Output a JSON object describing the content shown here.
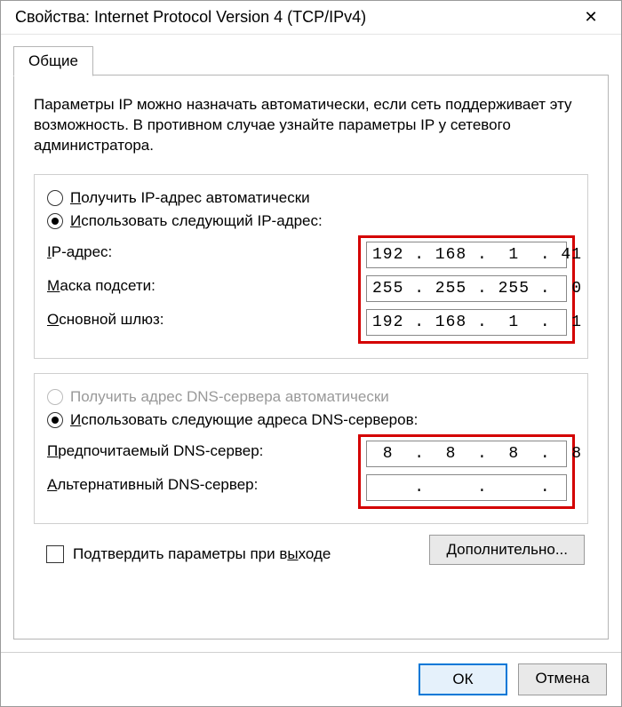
{
  "window": {
    "title": "Свойства: Internet Protocol Version 4 (TCP/IPv4)",
    "close": "✕"
  },
  "tab": {
    "general": "Общие"
  },
  "description": "Параметры IP можно назначать автоматически, если сеть поддерживает эту возможность. В противном случае узнайте параметры IP у сетевого администратора.",
  "ip": {
    "radio_auto": "Получить IP-адрес автоматически",
    "radio_manual_pre": "Использовать следующий IP-адрес:",
    "addr_label": "IP-адрес:",
    "addr_value": "192 . 168 .  1  . 41",
    "mask_label": "Маска подсети:",
    "mask_value": "255 . 255 . 255 .  0",
    "gw_label": "Основной шлюз:",
    "gw_value": "192 . 168 .  1  .  1"
  },
  "dns": {
    "radio_auto": "Получить адрес DNS-сервера автоматически",
    "radio_manual": "Использовать следующие адреса DNS-серверов:",
    "pref_label": "Предпочитаемый DNS-сервер:",
    "pref_value": " 8  .  8  .  8  .  8",
    "alt_label": "Альтернативный DNS-сервер:",
    "alt_value": "    .     .     .   "
  },
  "confirm": "Подтвердить параметры при выходе",
  "advanced": "Дополнительно...",
  "buttons": {
    "ok": "ОК",
    "cancel": "Отмена"
  },
  "underline": {
    "ip_auto": "П",
    "ip_manual": "И",
    "addr": "I",
    "mask": "М",
    "gw": "О",
    "dns_auto": "П",
    "dns_manual": "И",
    "pref": "П",
    "alt": "А",
    "confirm": "ы",
    "adv": "Д"
  }
}
